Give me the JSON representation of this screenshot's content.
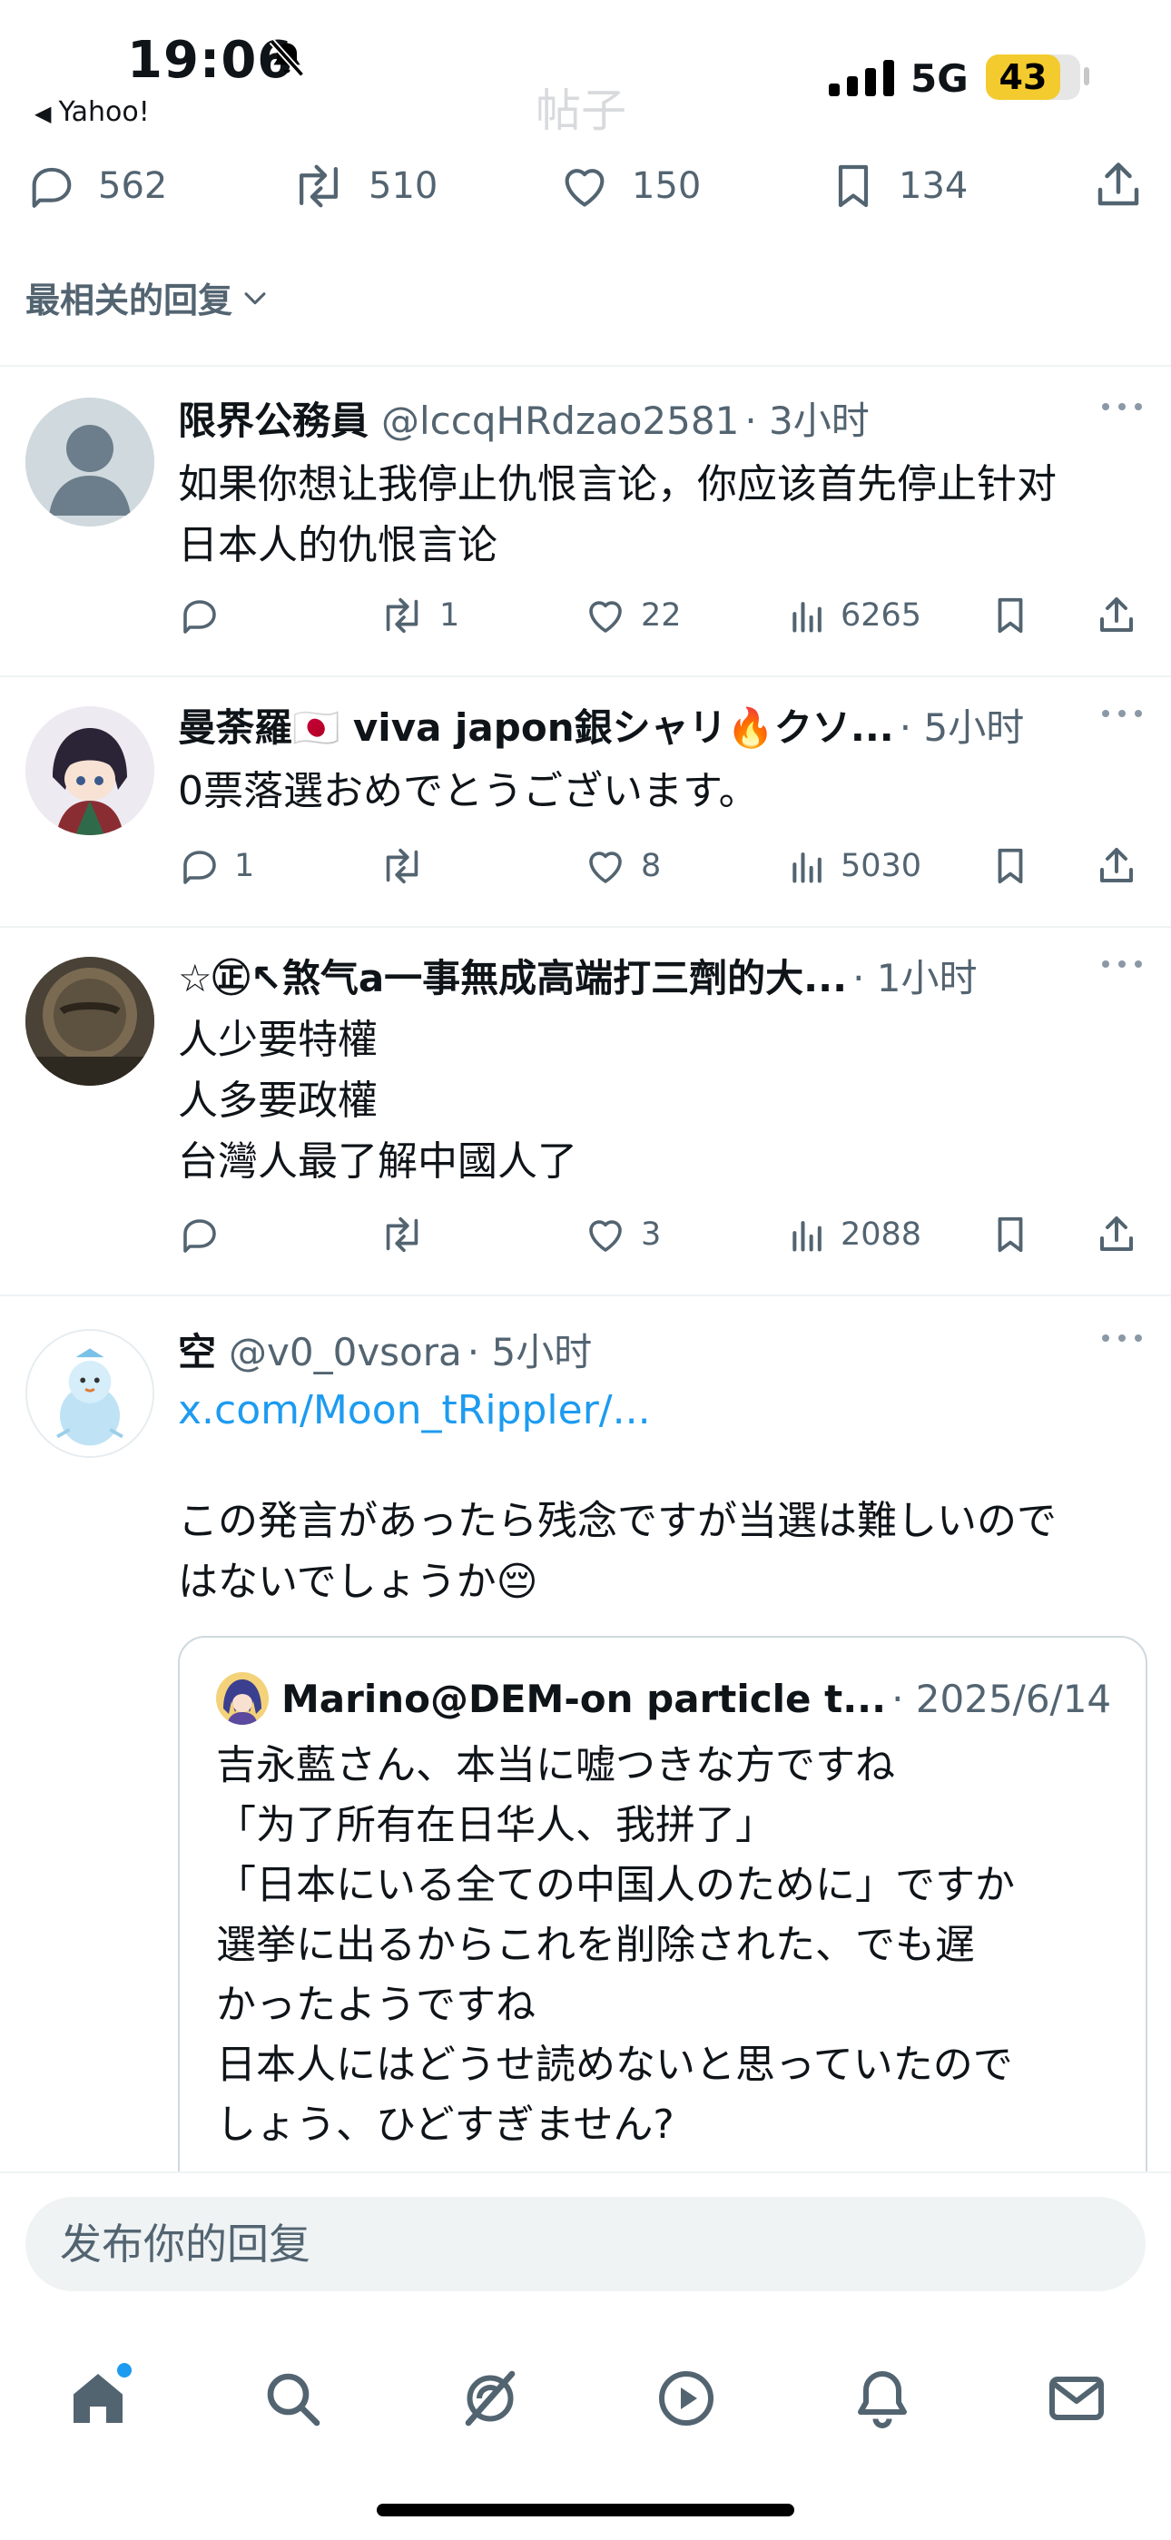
{
  "status_bar": {
    "time": "19:06",
    "back_app": "Yahoo!",
    "network": "5G",
    "battery": "43",
    "blurred_title": "帖子"
  },
  "post_stats": {
    "replies": "562",
    "reposts": "510",
    "likes": "150",
    "bookmarks": "134"
  },
  "sort_label": "最相关的回复",
  "replies": [
    {
      "name": "限界公務員",
      "handle": "@lccqHRdzao2581",
      "time": "· 3小时",
      "text": "如果你想让我停止仇恨言论，你应该首先停止针对\n日本人的仇恨言论",
      "reply_count": "",
      "repost_count": "1",
      "like_count": "22",
      "view_count": "6265"
    },
    {
      "name": "曼荼羅🇯🇵 viva japon銀シャリ🔥クソ...",
      "handle": "",
      "time": "· 5小时",
      "text": "0票落選おめでとうございます。",
      "reply_count": "1",
      "repost_count": "",
      "like_count": "8",
      "view_count": "5030"
    },
    {
      "name": "☆㊣↖煞气a一事無成高端打三劑的大...",
      "handle": "",
      "time": "· 1小时",
      "text": "人少要特權\n人多要政權\n台灣人最了解中國人了",
      "reply_count": "",
      "repost_count": "",
      "like_count": "3",
      "view_count": "2088"
    },
    {
      "name": "空",
      "handle": "@v0_0vsora",
      "time": "· 5小时",
      "link": "x.com/Moon_tRippler/...",
      "text": "この発言があったら残念ですが当選は難しいので\nはないでしょうか😔"
    }
  ],
  "quote": {
    "name": "Marino@DEM-on particle t...",
    "time": "· 2025/6/14",
    "text": "吉永藍さん、本当に嘘つきな方ですね\n「为了所有在日华人、我拼了」\n「日本にいる全ての中国人のために」ですか\n選挙に出るからこれを削除された、でも遅\nかったようですね\n日本人にはどうせ読めないと思っていたので\nしょう、ひどすぎません?"
  },
  "compose_placeholder": "发布你的回复",
  "tabs": [
    "home-icon",
    "search-icon",
    "grok-icon",
    "video-icon",
    "notifications-icon",
    "messages-icon"
  ],
  "colors": {
    "accent": "#1d9bf0",
    "muted": "#536471",
    "battery": "#f4cb2f"
  }
}
